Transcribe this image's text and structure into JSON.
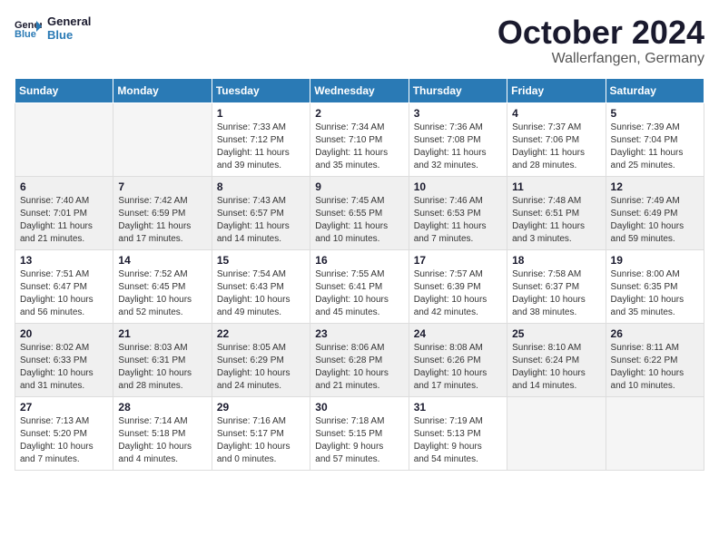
{
  "logo": {
    "line1": "General",
    "line2": "Blue"
  },
  "title": "October 2024",
  "location": "Wallerfangen, Germany",
  "header_days": [
    "Sunday",
    "Monday",
    "Tuesday",
    "Wednesday",
    "Thursday",
    "Friday",
    "Saturday"
  ],
  "weeks": [
    [
      {
        "day": "",
        "info": ""
      },
      {
        "day": "",
        "info": ""
      },
      {
        "day": "1",
        "info": "Sunrise: 7:33 AM\nSunset: 7:12 PM\nDaylight: 11 hours\nand 39 minutes."
      },
      {
        "day": "2",
        "info": "Sunrise: 7:34 AM\nSunset: 7:10 PM\nDaylight: 11 hours\nand 35 minutes."
      },
      {
        "day": "3",
        "info": "Sunrise: 7:36 AM\nSunset: 7:08 PM\nDaylight: 11 hours\nand 32 minutes."
      },
      {
        "day": "4",
        "info": "Sunrise: 7:37 AM\nSunset: 7:06 PM\nDaylight: 11 hours\nand 28 minutes."
      },
      {
        "day": "5",
        "info": "Sunrise: 7:39 AM\nSunset: 7:04 PM\nDaylight: 11 hours\nand 25 minutes."
      }
    ],
    [
      {
        "day": "6",
        "info": "Sunrise: 7:40 AM\nSunset: 7:01 PM\nDaylight: 11 hours\nand 21 minutes."
      },
      {
        "day": "7",
        "info": "Sunrise: 7:42 AM\nSunset: 6:59 PM\nDaylight: 11 hours\nand 17 minutes."
      },
      {
        "day": "8",
        "info": "Sunrise: 7:43 AM\nSunset: 6:57 PM\nDaylight: 11 hours\nand 14 minutes."
      },
      {
        "day": "9",
        "info": "Sunrise: 7:45 AM\nSunset: 6:55 PM\nDaylight: 11 hours\nand 10 minutes."
      },
      {
        "day": "10",
        "info": "Sunrise: 7:46 AM\nSunset: 6:53 PM\nDaylight: 11 hours\nand 7 minutes."
      },
      {
        "day": "11",
        "info": "Sunrise: 7:48 AM\nSunset: 6:51 PM\nDaylight: 11 hours\nand 3 minutes."
      },
      {
        "day": "12",
        "info": "Sunrise: 7:49 AM\nSunset: 6:49 PM\nDaylight: 10 hours\nand 59 minutes."
      }
    ],
    [
      {
        "day": "13",
        "info": "Sunrise: 7:51 AM\nSunset: 6:47 PM\nDaylight: 10 hours\nand 56 minutes."
      },
      {
        "day": "14",
        "info": "Sunrise: 7:52 AM\nSunset: 6:45 PM\nDaylight: 10 hours\nand 52 minutes."
      },
      {
        "day": "15",
        "info": "Sunrise: 7:54 AM\nSunset: 6:43 PM\nDaylight: 10 hours\nand 49 minutes."
      },
      {
        "day": "16",
        "info": "Sunrise: 7:55 AM\nSunset: 6:41 PM\nDaylight: 10 hours\nand 45 minutes."
      },
      {
        "day": "17",
        "info": "Sunrise: 7:57 AM\nSunset: 6:39 PM\nDaylight: 10 hours\nand 42 minutes."
      },
      {
        "day": "18",
        "info": "Sunrise: 7:58 AM\nSunset: 6:37 PM\nDaylight: 10 hours\nand 38 minutes."
      },
      {
        "day": "19",
        "info": "Sunrise: 8:00 AM\nSunset: 6:35 PM\nDaylight: 10 hours\nand 35 minutes."
      }
    ],
    [
      {
        "day": "20",
        "info": "Sunrise: 8:02 AM\nSunset: 6:33 PM\nDaylight: 10 hours\nand 31 minutes."
      },
      {
        "day": "21",
        "info": "Sunrise: 8:03 AM\nSunset: 6:31 PM\nDaylight: 10 hours\nand 28 minutes."
      },
      {
        "day": "22",
        "info": "Sunrise: 8:05 AM\nSunset: 6:29 PM\nDaylight: 10 hours\nand 24 minutes."
      },
      {
        "day": "23",
        "info": "Sunrise: 8:06 AM\nSunset: 6:28 PM\nDaylight: 10 hours\nand 21 minutes."
      },
      {
        "day": "24",
        "info": "Sunrise: 8:08 AM\nSunset: 6:26 PM\nDaylight: 10 hours\nand 17 minutes."
      },
      {
        "day": "25",
        "info": "Sunrise: 8:10 AM\nSunset: 6:24 PM\nDaylight: 10 hours\nand 14 minutes."
      },
      {
        "day": "26",
        "info": "Sunrise: 8:11 AM\nSunset: 6:22 PM\nDaylight: 10 hours\nand 10 minutes."
      }
    ],
    [
      {
        "day": "27",
        "info": "Sunrise: 7:13 AM\nSunset: 5:20 PM\nDaylight: 10 hours\nand 7 minutes."
      },
      {
        "day": "28",
        "info": "Sunrise: 7:14 AM\nSunset: 5:18 PM\nDaylight: 10 hours\nand 4 minutes."
      },
      {
        "day": "29",
        "info": "Sunrise: 7:16 AM\nSunset: 5:17 PM\nDaylight: 10 hours\nand 0 minutes."
      },
      {
        "day": "30",
        "info": "Sunrise: 7:18 AM\nSunset: 5:15 PM\nDaylight: 9 hours\nand 57 minutes."
      },
      {
        "day": "31",
        "info": "Sunrise: 7:19 AM\nSunset: 5:13 PM\nDaylight: 9 hours\nand 54 minutes."
      },
      {
        "day": "",
        "info": ""
      },
      {
        "day": "",
        "info": ""
      }
    ]
  ]
}
